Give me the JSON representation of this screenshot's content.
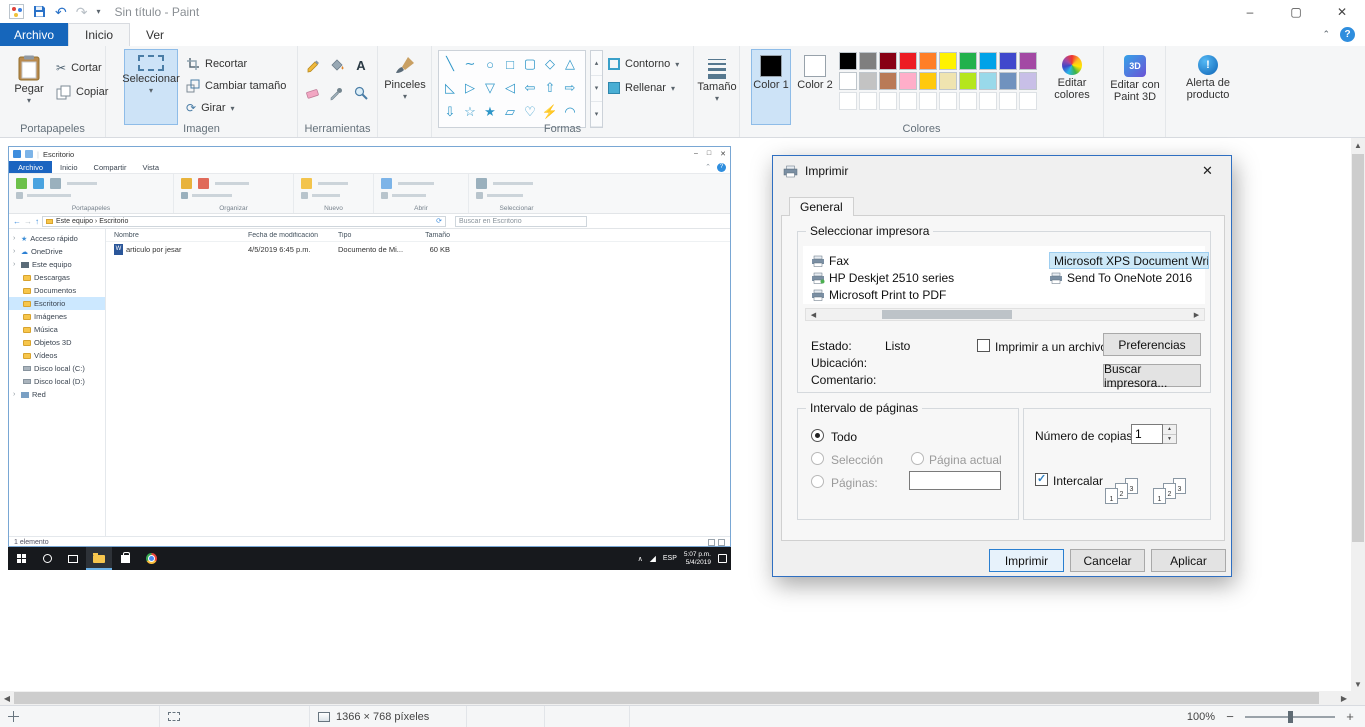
{
  "titlebar": {
    "title": "Sin título - Paint"
  },
  "tabs": {
    "archivo": "Archivo",
    "inicio": "Inicio",
    "ver": "Ver"
  },
  "ribbon": {
    "paste": "Pegar",
    "cut": "Cortar",
    "copy": "Copiar",
    "clipboard_label": "Portapapeles",
    "select": "Seleccionar",
    "crop": "Recortar",
    "resize": "Cambiar tamaño",
    "rotate": "Girar",
    "image_label": "Imagen",
    "tools_label": "Herramientas",
    "brushes": "Pinceles",
    "outline": "Contorno",
    "fill": "Rellenar",
    "shapes_label": "Formas",
    "size": "Tamaño",
    "color1": "Color 1",
    "color2": "Color 2",
    "edit_colors": "Editar colores",
    "colors_label": "Colores",
    "paint3d": "Editar con Paint 3D",
    "product_alert": "Alerta de producto",
    "palette": {
      "row1": [
        "#000000",
        "#7f7f7f",
        "#880015",
        "#ed1c24",
        "#ff7f27",
        "#fff200",
        "#22b14c",
        "#00a2e8",
        "#3f48cc",
        "#a349a4"
      ],
      "row2": [
        "#ffffff",
        "#c3c3c3",
        "#b97a57",
        "#ffaec9",
        "#ffc90e",
        "#efe4b0",
        "#b5e61d",
        "#99d9ea",
        "#7092be",
        "#c8bfe7"
      ]
    },
    "shapes": [
      "╲",
      "∼",
      "○",
      "□",
      "▢",
      "◇",
      "△",
      "◺",
      "▷",
      "▽",
      "◁",
      "⇦",
      "⇧",
      "⇨",
      "⇩",
      "☆",
      "★",
      "▱",
      "♡",
      "⚡",
      "◠"
    ]
  },
  "dialog": {
    "title": "Imprimir",
    "tab_general": "General",
    "group_printer": "Seleccionar impresora",
    "printers_left": [
      "Fax",
      "HP Deskjet 2510 series",
      "Microsoft Print to PDF"
    ],
    "printers_right": [
      "Microsoft XPS Document Writer",
      "Send To OneNote 2016"
    ],
    "estado_label": "Estado:",
    "estado_value": "Listo",
    "ubicacion_label": "Ubicación:",
    "comentario_label": "Comentario:",
    "print_to_file": "Imprimir a un archivo",
    "preferences": "Preferencias",
    "find_printer": "Buscar impresora...",
    "group_range": "Intervalo de páginas",
    "range_all": "Todo",
    "range_selection": "Selección",
    "range_current": "Página actual",
    "range_pages": "Páginas:",
    "copies_label": "Número de copias:",
    "copies_value": "1",
    "collate": "Intercalar",
    "collate_numbers": [
      "1",
      "2",
      "3"
    ],
    "btn_print": "Imprimir",
    "btn_cancel": "Cancelar",
    "btn_apply": "Aplicar"
  },
  "canvas": {
    "explorer": {
      "window_title": "Escritorio",
      "tab_archivo": "Archivo",
      "tabs": [
        "Inicio",
        "Compartir",
        "Vista"
      ],
      "ribbon_groups": [
        "Portapapeles",
        "Organizar",
        "Nuevo",
        "Abrir",
        "Seleccionar"
      ],
      "breadcrumb": "Este equipo › Escritorio",
      "search_placeholder": "Buscar en Escritorio",
      "nav": [
        "Acceso rápido",
        "OneDrive",
        "Este equipo",
        "Descargas",
        "Documentos",
        "Escritorio",
        "Imágenes",
        "Música",
        "Objetos 3D",
        "Vídeos",
        "Disco local (C:)",
        "Disco local (D:)",
        "Red"
      ],
      "columns": [
        "Nombre",
        "Fecha de modificación",
        "Tipo",
        "Tamaño"
      ],
      "file": {
        "name": "articulo por jesar",
        "date": "4/5/2019 6:45 p.m.",
        "type": "Documento de Mi...",
        "size": "60 KB"
      },
      "items_count": "1 elemento"
    },
    "taskbar": {
      "time": "5:07 p.m.",
      "date": "5/4/2019"
    }
  },
  "statusbar": {
    "image_size": "1366 × 768 píxeles",
    "zoom": "100%"
  }
}
